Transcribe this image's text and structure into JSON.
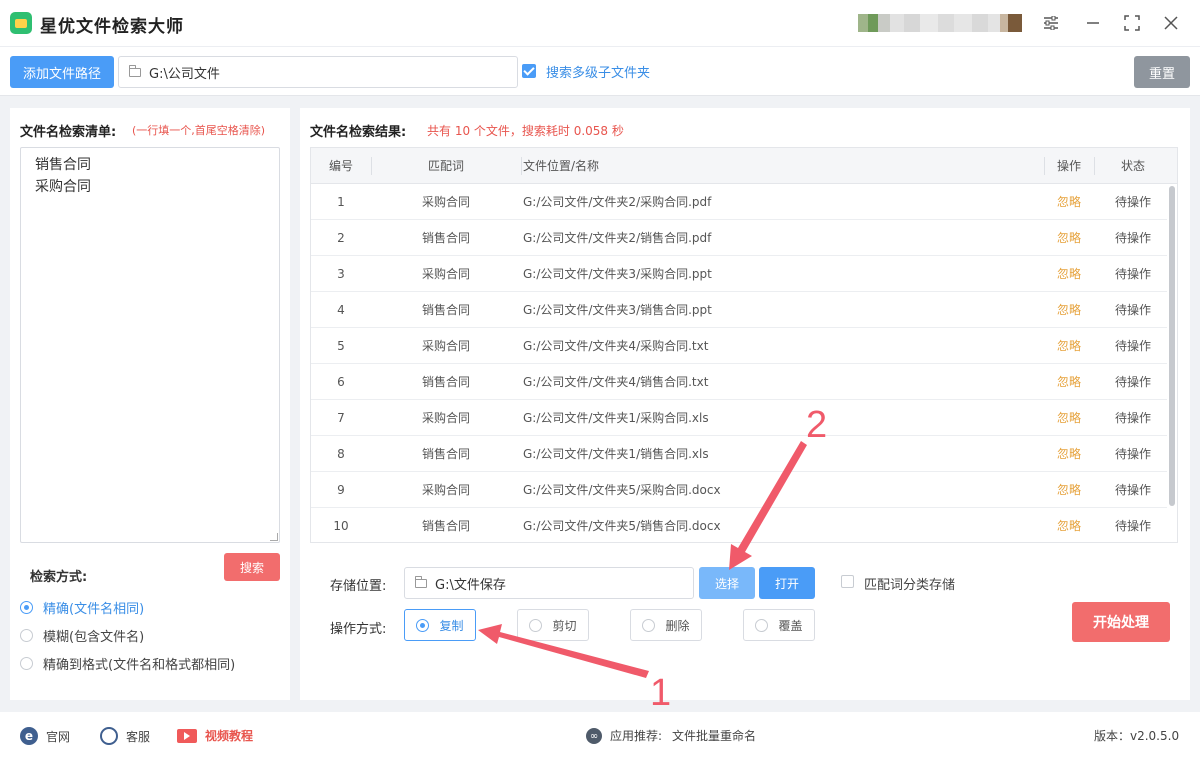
{
  "app": {
    "title": "星优文件检索大师"
  },
  "toolbar": {
    "add_path_label": "添加文件路径",
    "path_value": "G:\\公司文件",
    "subfolder_checked": true,
    "subfolder_label": "搜索多级子文件夹",
    "reset_label": "重置"
  },
  "left": {
    "title": "文件名检索清单:",
    "hint": "(一行填一个,首尾空格清除)",
    "terms": [
      "销售合同",
      "采购合同"
    ],
    "search_method_label": "检索方式:",
    "search_button": "搜索",
    "methods": [
      {
        "label": "精确(文件名相同)",
        "selected": true
      },
      {
        "label": "模糊(包含文件名)",
        "selected": false
      },
      {
        "label": "精确到格式(文件名和格式都相同)",
        "selected": false
      }
    ]
  },
  "results": {
    "title": "文件名检索结果:",
    "summary": "共有 10 个文件，搜索耗时 0.058 秒",
    "columns": [
      "编号",
      "匹配词",
      "文件位置/名称",
      "操作",
      "状态"
    ],
    "rows": [
      {
        "no": "1",
        "keyword": "采购合同",
        "path": "G:/公司文件/文件夹2/采购合同.pdf",
        "action": "忽略",
        "status": "待操作"
      },
      {
        "no": "2",
        "keyword": "销售合同",
        "path": "G:/公司文件/文件夹2/销售合同.pdf",
        "action": "忽略",
        "status": "待操作"
      },
      {
        "no": "3",
        "keyword": "采购合同",
        "path": "G:/公司文件/文件夹3/采购合同.ppt",
        "action": "忽略",
        "status": "待操作"
      },
      {
        "no": "4",
        "keyword": "销售合同",
        "path": "G:/公司文件/文件夹3/销售合同.ppt",
        "action": "忽略",
        "status": "待操作"
      },
      {
        "no": "5",
        "keyword": "采购合同",
        "path": "G:/公司文件/文件夹4/采购合同.txt",
        "action": "忽略",
        "status": "待操作"
      },
      {
        "no": "6",
        "keyword": "销售合同",
        "path": "G:/公司文件/文件夹4/销售合同.txt",
        "action": "忽略",
        "status": "待操作"
      },
      {
        "no": "7",
        "keyword": "采购合同",
        "path": "G:/公司文件/文件夹1/采购合同.xls",
        "action": "忽略",
        "status": "待操作"
      },
      {
        "no": "8",
        "keyword": "销售合同",
        "path": "G:/公司文件/文件夹1/销售合同.xls",
        "action": "忽略",
        "status": "待操作"
      },
      {
        "no": "9",
        "keyword": "采购合同",
        "path": "G:/公司文件/文件夹5/采购合同.docx",
        "action": "忽略",
        "status": "待操作"
      },
      {
        "no": "10",
        "keyword": "销售合同",
        "path": "G:/公司文件/文件夹5/销售合同.docx",
        "action": "忽略",
        "status": "待操作"
      }
    ]
  },
  "storage": {
    "label": "存储位置:",
    "value": "G:\\文件保存",
    "select_label": "选择",
    "open_label": "打开",
    "classify_checked": false,
    "classify_label": "匹配词分类存储"
  },
  "operation": {
    "label": "操作方式:",
    "options": [
      {
        "label": "复制",
        "selected": true
      },
      {
        "label": "剪切",
        "selected": false
      },
      {
        "label": "删除",
        "selected": false
      },
      {
        "label": "覆盖",
        "selected": false
      }
    ],
    "start_label": "开始处理"
  },
  "statusbar": {
    "website": "官网",
    "service": "客服",
    "video": "视频教程",
    "recommend_prefix": "应用推荐:",
    "recommend_app": "文件批量重命名",
    "version": "版本：v2.0.5.0"
  },
  "annotations": [
    "1",
    "2"
  ],
  "colors": {
    "primary": "#4a9cf7",
    "danger": "#f26d6d",
    "warning": "#e6a23c",
    "accent_text": "#e8554e"
  }
}
